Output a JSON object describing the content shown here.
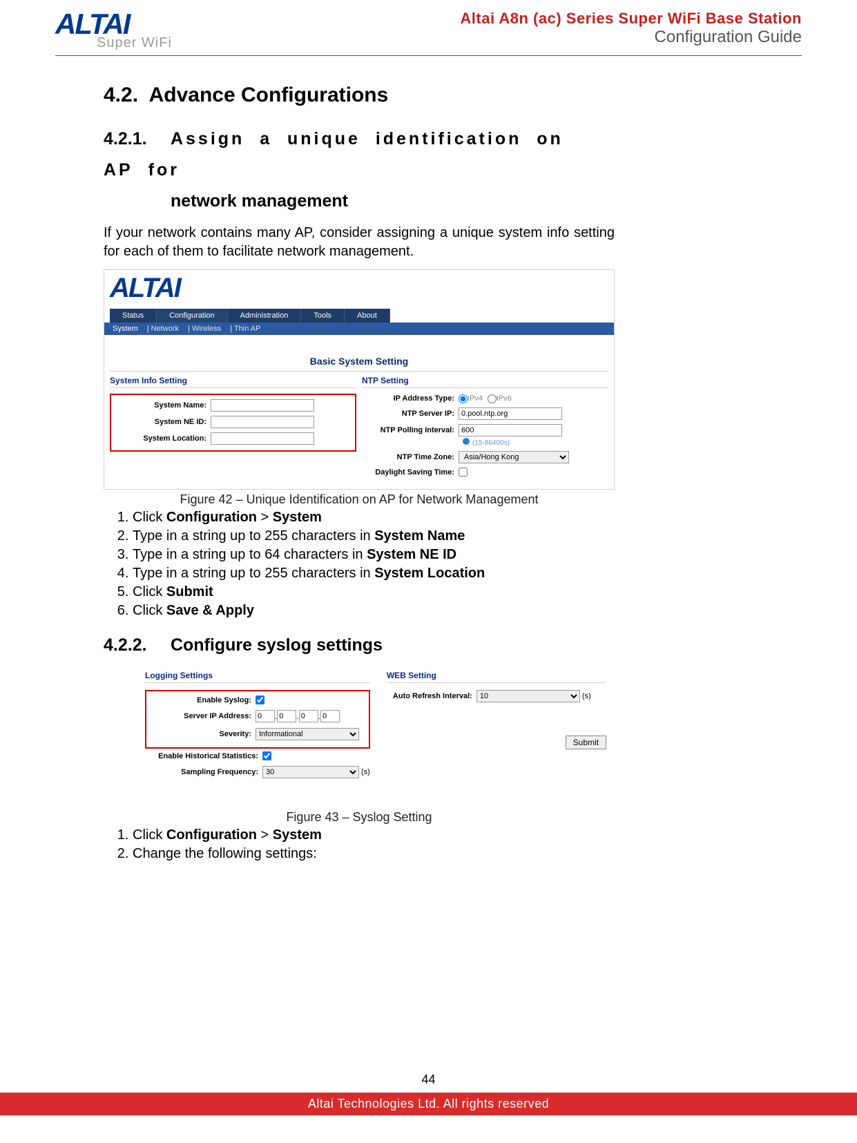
{
  "header": {
    "logo_text": "ALTAI",
    "logo_sub": "Super WiFi",
    "title": "Altai A8n (ac) Series Super WiFi Base Station",
    "subtitle": "Configuration Guide"
  },
  "section_4_2": {
    "num": "4.2.",
    "title": "Advance Configurations"
  },
  "section_4_2_1": {
    "num": "4.2.1.",
    "title": "Assign a unique identification on AP for network management",
    "title_line2_prefix": "network management",
    "para": "If your network contains many AP, consider assigning a unique system info setting for each of them to facilitate network management."
  },
  "figure42": {
    "caption": "Figure 42 – Unique Identification on AP for Network Management",
    "logo": "ALTAI",
    "tabs": [
      "Status",
      "Configuration",
      "Administration",
      "Tools",
      "About"
    ],
    "subtabs": [
      "System",
      "Network",
      "Wireless",
      "Thin AP"
    ],
    "basic_title": "Basic System Setting",
    "left_head": "System Info Setting",
    "right_head": "NTP Setting",
    "fields": {
      "system_name": {
        "label": "System Name:",
        "value": ""
      },
      "system_ne_id": {
        "label": "System NE ID:",
        "value": ""
      },
      "system_location": {
        "label": "System Location:",
        "value": ""
      }
    },
    "ntp": {
      "ip_type_label": "IP Address Type:",
      "ipv4": "IPv4",
      "ipv6": "IPv6",
      "server_label": "NTP Server IP:",
      "server_value": "0.pool.ntp.org",
      "poll_label": "NTP Polling Interval:",
      "poll_value": "600",
      "poll_hint": "(15-86400s)",
      "tz_label": "NTP Time Zone:",
      "tz_value": "Asia/Hong Kong",
      "dst_label": "Daylight Saving Time:"
    }
  },
  "steps1": {
    "s1a": "Click ",
    "s1b": "Configuration",
    "s1c": " > ",
    "s1d": "System",
    "s2a": "Type in a string up to 255 characters in ",
    "s2b": "System Name",
    "s3a": "Type in a string up to 64 characters in ",
    "s3b": "System NE ID",
    "s4a": "Type in a string up to 255 characters in ",
    "s4b": "System Location",
    "s5a": "Click ",
    "s5b": "Submit",
    "s6a": "Click ",
    "s6b": "Save & Apply"
  },
  "section_4_2_2": {
    "num": "4.2.2.",
    "title": "Configure syslog settings"
  },
  "figure43": {
    "caption": "Figure 43 – Syslog Setting",
    "left_head": "Logging Settings",
    "right_head": "WEB Setting",
    "enable_syslog_label": "Enable Syslog:",
    "server_ip_label": "Server IP Address:",
    "ip": [
      "0",
      "0",
      "0",
      "0"
    ],
    "severity_label": "Severity:",
    "severity_value": "Informational",
    "hist_label": "Enable Historical Statistics:",
    "samp_label": "Sampling Frequency:",
    "samp_value": "30",
    "samp_unit": "(s)",
    "auto_label": "Auto Refresh Interval:",
    "auto_value": "10",
    "auto_unit": "(s)",
    "submit": "Submit"
  },
  "steps2": {
    "s1a": "Click ",
    "s1b": "Configuration",
    "s1c": " > ",
    "s1d": "System",
    "s2": "Change the following settings:"
  },
  "footer": {
    "page": "44",
    "copyright": "Altai Technologies Ltd. All rights reserved"
  }
}
